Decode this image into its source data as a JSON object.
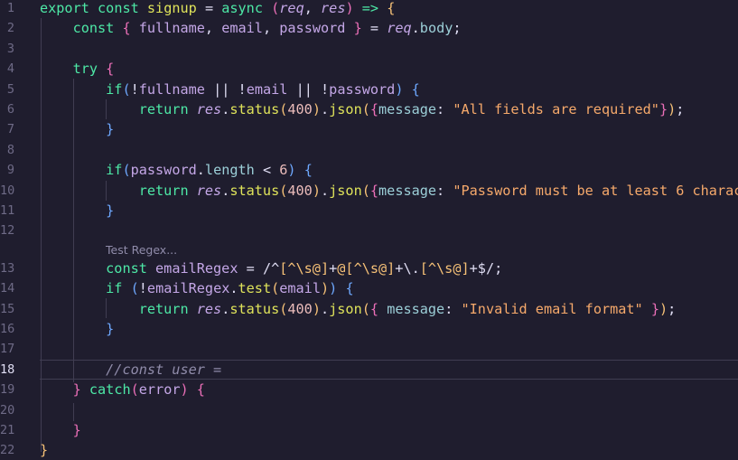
{
  "editor": {
    "line_numbers": [
      "1",
      "2",
      "3",
      "4",
      "5",
      "6",
      "7",
      "8",
      "9",
      "10",
      "11",
      "12",
      "13",
      "14",
      "15",
      "16",
      "17",
      "18",
      "19",
      "20",
      "21",
      "22"
    ],
    "active_line": "18",
    "code_lens": "Test Regex...",
    "code": {
      "l1": [
        "export",
        "const",
        "signup",
        "=",
        "async",
        "(",
        "req",
        ",",
        "res",
        ")",
        "=>",
        "{"
      ],
      "l2": [
        "const",
        "{",
        "fullname",
        ",",
        "email",
        ",",
        "password",
        "}",
        "=",
        "req",
        ".",
        "body",
        ";"
      ],
      "l4": [
        "try",
        "{"
      ],
      "l5": [
        "if",
        "(",
        "!",
        "fullname",
        "||",
        "!",
        "email",
        "||",
        "!",
        "password",
        ")",
        "{"
      ],
      "l6": [
        "return",
        "res",
        ".",
        "status",
        "(",
        "400",
        ")",
        ".",
        "json",
        "(",
        "{",
        "message",
        ":",
        "\"All fields are required\"",
        "}",
        ")",
        ";"
      ],
      "l7": [
        "}"
      ],
      "l9": [
        "if",
        "(",
        "password",
        ".",
        "length",
        "<",
        "6",
        ")",
        "{"
      ],
      "l10": [
        "return",
        "res",
        ".",
        "status",
        "(",
        "400",
        ")",
        ".",
        "json",
        "(",
        "{",
        "message",
        ":",
        "\"Password must be at least 6 charac"
      ],
      "l11": [
        "}"
      ],
      "l13": [
        "const",
        "emailRegex",
        "=",
        "/^",
        "[^\\s@]",
        "+",
        "@",
        "[^\\s@]",
        "+",
        "\\.",
        "[^\\s@]",
        "+",
        "$",
        "/",
        ";"
      ],
      "l14": [
        "if",
        "(",
        "!",
        "emailRegex",
        ".",
        "test",
        "(",
        "email",
        ")",
        ")",
        "{"
      ],
      "l15": [
        "return",
        "res",
        ".",
        "status",
        "(",
        "400",
        ")",
        ".",
        "json",
        "(",
        "{",
        "message",
        ":",
        "\"Invalid email format\"",
        "}",
        ")",
        ";"
      ],
      "l16": [
        "}"
      ],
      "l18": [
        "//const user ="
      ],
      "l19": [
        "}",
        "catch",
        "(",
        "error",
        ")",
        "{"
      ],
      "l21": [
        "}"
      ],
      "l22": [
        "}"
      ]
    }
  },
  "colors": {
    "background": "#1f1d2e",
    "keyword": "#4de8a6",
    "function": "#dfe35a",
    "variable": "#c4a7e7",
    "property": "#9ccfd8",
    "string": "#f6a96b",
    "number": "#ebbcba",
    "comment": "#908caa",
    "line_number": "#6e6a86"
  }
}
